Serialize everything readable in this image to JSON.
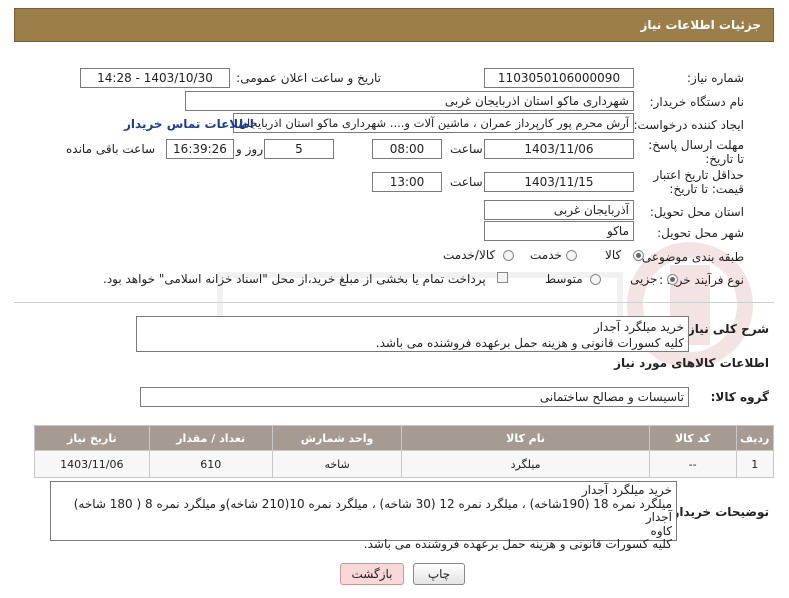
{
  "header": {
    "title": "جزئیات اطلاعات نیاز"
  },
  "need_number": {
    "label": "شماره نیاز:",
    "value": "1103050106000090"
  },
  "announce": {
    "label": "تاریخ و ساعت اعلان عمومی:",
    "value": "1403/10/30 - 14:28"
  },
  "buyer": {
    "label": "نام دستگاه خریدار:",
    "value": "شهرداری ماکو استان اذربایجان غربی"
  },
  "creator": {
    "label": "ایجاد کننده درخواست:",
    "value": "آرش محرم پور کارپرداز عمران ، ماشین آلات و.... شهرداری ماکو استان اذربایجان",
    "contact_link": "اطلاعات تماس خریدار"
  },
  "deadline": {
    "label": "مهلت ارسال پاسخ: تا تاریخ:",
    "date": "1403/11/06",
    "time_label": "ساعت",
    "time": "08:00",
    "days": "5",
    "days_label": "روز و",
    "remaining": "16:39:26",
    "remaining_label": "ساعت باقی مانده"
  },
  "validity": {
    "label": "حداقل تاریخ اعتبار قیمت: تا تاریخ:",
    "date": "1403/11/15",
    "time_label": "ساعت",
    "time": "13:00"
  },
  "province": {
    "label": "استان محل تحویل:",
    "value": "آذربایجان غربی"
  },
  "city": {
    "label": "شهر محل تحویل:",
    "value": "ماکو"
  },
  "category": {
    "label": "طبقه بندی موضوعی:",
    "options": [
      "کالا",
      "خدمت",
      "کالا/خدمت"
    ],
    "selected": "کالا"
  },
  "purchase_type": {
    "label": "نوع فرآیند خرید :",
    "options": [
      "جزیی",
      "متوسط"
    ],
    "selected": "جزیی",
    "note": "پرداخت تمام یا بخشی از مبلغ خرید،از محل \"اسناد خزانه اسلامی\" خواهد بود."
  },
  "description": {
    "label": "شرح کلی نیاز:",
    "line1": "خرید میلگرد آجدار",
    "line2": "کلیه کسورات قانونی و هزینه حمل برعهده فروشنده می باشد."
  },
  "goods_info_title": "اطلاعات کالاهای مورد نیاز",
  "goods_group": {
    "label": "گروه کالا:",
    "value": "تاسیسات و مصالح ساختمانی"
  },
  "table": {
    "headers": [
      "ردیف",
      "کد کالا",
      "نام کالا",
      "واحد شمارش",
      "تعداد / مقدار",
      "تاریخ نیاز"
    ],
    "rows": [
      [
        "1",
        "--",
        "میلگرد",
        "شاخه",
        "610",
        "1403/11/06"
      ]
    ]
  },
  "buyer_notes": {
    "label": "توضیحات خریدار:",
    "line1": "خرید میلگرد آجدار",
    "line2": "میلگرد نمره 18 (190شاخه) ، میلگرد نمره 12 (30 شاخه) ، میلگرد نمره 10(210 شاخه)و میلگرد نمره 8 ( 180 شاخه) آجدار",
    "line3": "کاوه",
    "line4": "کلیه کسورات قانونی و هزینه حمل برعهده فروشنده می باشد."
  },
  "buttons": {
    "print": "چاپ",
    "back": "بازگشت"
  },
  "colors": {
    "header_bg": "#9b7e4a",
    "table_header_bg": "#a59b92",
    "link": "#1a3e9c",
    "back_button_bg": "#f7d7d7"
  }
}
